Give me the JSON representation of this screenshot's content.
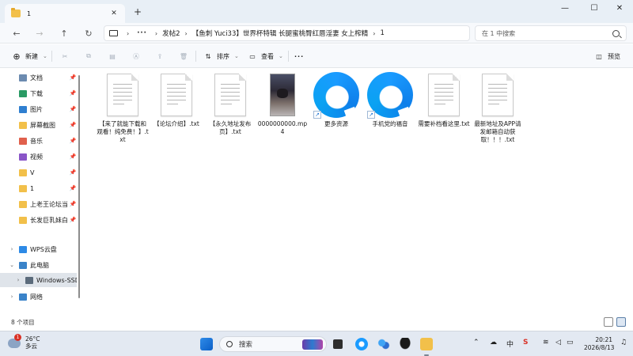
{
  "tab": {
    "title": "1",
    "close": "✕",
    "new": "+"
  },
  "window_controls": {
    "minimize": "—",
    "maximize": "☐",
    "close": "✕"
  },
  "nav": {
    "back": "←",
    "forward": "→",
    "up": "↑",
    "refresh": "↻"
  },
  "breadcrumb": {
    "more": "···",
    "items": [
      "发帖2",
      "【鱼刺 Yuci33】世界杯特辑 长腿蜜桃臀红唇淫妻 女上榨精",
      "1"
    ],
    "separator": "›"
  },
  "search": {
    "placeholder": "在 1 中搜索"
  },
  "toolbar": {
    "new_label": "新建",
    "sort_label": "排序",
    "view_label": "查看",
    "more_label": "···",
    "preview_label": "预览"
  },
  "sidebar": {
    "quick_access": [
      {
        "label": "文档",
        "icon": "documents-icon",
        "color": "#6c8bb0"
      },
      {
        "label": "下载",
        "icon": "download-icon",
        "color": "#2a9a64"
      },
      {
        "label": "图片",
        "icon": "pictures-icon",
        "color": "#2f7fd0"
      },
      {
        "label": "屏幕截图",
        "icon": "folder-icon",
        "color": "#f2c04a"
      },
      {
        "label": "音乐",
        "icon": "music-icon",
        "color": "#e0604c"
      },
      {
        "label": "视频",
        "icon": "videos-icon",
        "color": "#8a55c8"
      },
      {
        "label": "V",
        "icon": "folder-icon",
        "color": "#f2c04a"
      },
      {
        "label": "1",
        "icon": "folder-icon",
        "color": "#f2c04a"
      },
      {
        "label": "上老王论坛当",
        "icon": "folder-icon",
        "color": "#f2c04a"
      },
      {
        "label": "长发巨乳妹白",
        "icon": "folder-icon",
        "color": "#f2c04a"
      }
    ],
    "tree": [
      {
        "label": "WPS云盘",
        "icon": "cloud-icon",
        "color": "#2d8ae6",
        "chevron": "›",
        "indent": 0
      },
      {
        "label": "此电脑",
        "icon": "computer-icon",
        "color": "#3a83c9",
        "chevron": "⌄",
        "indent": 0
      },
      {
        "label": "Windows-SSD",
        "icon": "drive-icon",
        "color": "#5b6b7b",
        "chevron": "›",
        "indent": 1
      },
      {
        "label": "网络",
        "icon": "network-icon",
        "color": "#3a83c9",
        "chevron": "›",
        "indent": 0
      }
    ],
    "pin": "📌"
  },
  "files": [
    {
      "name": "【来了就能下载和观看！纯免费！】.txt",
      "type": "txt"
    },
    {
      "name": "【论坛介绍】.txt",
      "type": "txt"
    },
    {
      "name": "【永久地址发布页】.txt",
      "type": "txt"
    },
    {
      "name": "0000000000.mp4",
      "type": "video"
    },
    {
      "name": "更多资源",
      "type": "shortcut"
    },
    {
      "name": "手机党的福音",
      "type": "shortcut"
    },
    {
      "name": "需要补档看这里.txt",
      "type": "txt"
    },
    {
      "name": "最新地址及APP请发邮箱自动获取！！！.txt",
      "type": "txt"
    }
  ],
  "status": {
    "count": "8 个项目"
  },
  "taskbar": {
    "weather_temp": "26°C",
    "weather_desc": "多云",
    "weather_badge": "1",
    "search_label": "搜索",
    "time": "20:21",
    "date": "2026/8/13",
    "tray_chevron": "⌃",
    "input_method": "中"
  },
  "colors": {
    "accent": "#0e7fea",
    "folder": "#f2c04a",
    "selected": "#dfe4ea"
  }
}
